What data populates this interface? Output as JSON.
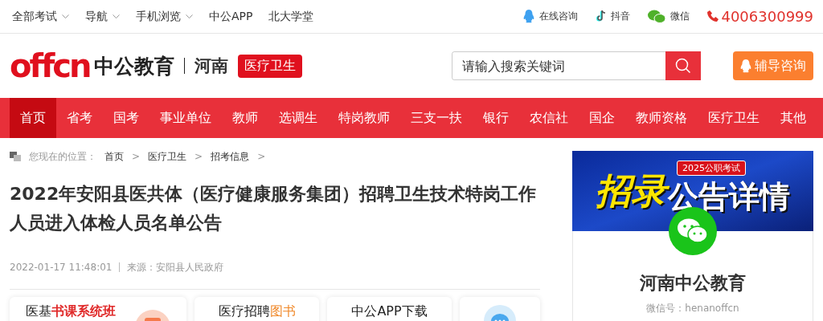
{
  "top_bar": {
    "left_links": [
      {
        "label": "全部考试",
        "dropdown": true
      },
      {
        "label": "导航",
        "dropdown": true
      },
      {
        "label": "手机浏览",
        "dropdown": true
      },
      {
        "label": "中公APP",
        "dropdown": false
      },
      {
        "label": "北大学堂",
        "dropdown": false
      }
    ],
    "right_links": [
      {
        "kind": "qq",
        "label": "在线咨询"
      },
      {
        "kind": "douyin",
        "label": "抖音"
      },
      {
        "kind": "wechat",
        "label": "微信"
      },
      {
        "kind": "phone",
        "label": "4006300999"
      }
    ]
  },
  "header": {
    "logo_text": "offcn",
    "brand": "中公教育",
    "region": "河南",
    "channel_tag": "医疗卫生",
    "search": {
      "placeholder": "请输入搜索关键词"
    },
    "consult_button": "辅导咨询"
  },
  "nav": [
    {
      "label": "首页",
      "selected": true
    },
    {
      "label": "省考",
      "selected": false
    },
    {
      "label": "国考",
      "selected": false
    },
    {
      "label": "事业单位",
      "selected": false
    },
    {
      "label": "教师",
      "selected": false
    },
    {
      "label": "选调生",
      "selected": false
    },
    {
      "label": "特岗教师",
      "selected": false
    },
    {
      "label": "三支一扶",
      "selected": false
    },
    {
      "label": "银行",
      "selected": false
    },
    {
      "label": "农信社",
      "selected": false
    },
    {
      "label": "国企",
      "selected": false
    },
    {
      "label": "教师资格",
      "selected": false
    },
    {
      "label": "医疗卫生",
      "selected": false
    },
    {
      "label": "其他",
      "selected": false
    }
  ],
  "breadcrumb": {
    "label": "您现在的位置：",
    "items": [
      {
        "label": "首页",
        "separator": ">"
      },
      {
        "label": "医疗卫生",
        "separator": ">"
      },
      {
        "label": "招考信息",
        "separator": ">"
      }
    ]
  },
  "article": {
    "title": "2022年安阳县医共体（医疗健康服务集团）招聘卫生技术特岗工作人员进入体检人员名单公告",
    "date": "2022-01-17 11:48:01",
    "source_label": "来源：",
    "source": "安阳县人民政府"
  },
  "promo_cards": [
    {
      "kind": "text",
      "lead": "医基",
      "highlight": "书课系统班",
      "color": "#e02a2a"
    },
    {
      "kind": "text",
      "lead": "医疗招聘",
      "highlight": "图书",
      "color": "#f08a2c"
    },
    {
      "kind": "text",
      "lead": "中公APP下载"
    },
    {
      "kind": "icon"
    }
  ],
  "sidebar": {
    "banner": {
      "badge": "2025公职考试",
      "headline_script": "招录",
      "headline": "公告详情"
    },
    "account_name": "河南中公教育",
    "account_id_label": "微信号：",
    "account_id": "henanoffcn"
  }
}
